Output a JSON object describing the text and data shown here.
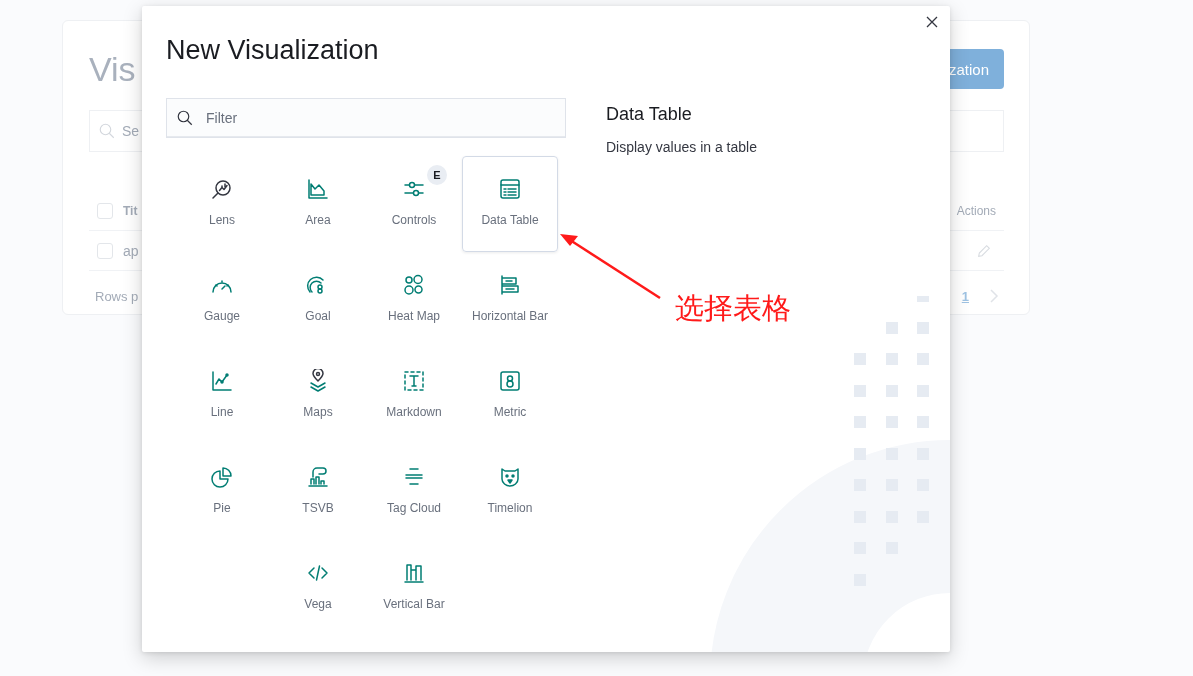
{
  "background_page": {
    "title": "Vis",
    "create_button": "zation",
    "search": {
      "placeholder": "Se"
    },
    "table": {
      "header": {
        "checked": false,
        "columns": [
          "Tit",
          "Actions"
        ]
      },
      "rows": [
        {
          "checked": false,
          "cell": "ap"
        }
      ]
    },
    "footer": {
      "rows_per_page": "Rows p",
      "pages": [
        {
          "label": "1",
          "selected": true
        }
      ]
    }
  },
  "modal": {
    "title": "New Visualization",
    "filter": {
      "placeholder": "Filter"
    },
    "types": [
      {
        "label": "Lens",
        "selected": false
      },
      {
        "label": "Area",
        "selected": false
      },
      {
        "label": "Controls",
        "selected": false,
        "badge": "E"
      },
      {
        "label": "Data Table",
        "selected": true
      },
      {
        "label": "Gauge",
        "selected": false
      },
      {
        "label": "Goal",
        "selected": false
      },
      {
        "label": "Heat Map",
        "selected": false
      },
      {
        "label": "Horizontal Bar",
        "selected": false
      },
      {
        "label": "Line",
        "selected": false
      },
      {
        "label": "Maps",
        "selected": false
      },
      {
        "label": "Markdown",
        "selected": false
      },
      {
        "label": "Metric",
        "selected": false
      },
      {
        "label": "Pie",
        "selected": false
      },
      {
        "label": "TSVB",
        "selected": false
      },
      {
        "label": "Tag Cloud",
        "selected": false
      },
      {
        "label": "Timelion",
        "selected": false
      },
      {
        "label": "Vega",
        "selected": false
      },
      {
        "label": "Vertical Bar",
        "selected": false
      }
    ],
    "description": {
      "title": "Data Table",
      "text": "Display values in a table"
    }
  },
  "annotation": {
    "text": "选择表格"
  }
}
